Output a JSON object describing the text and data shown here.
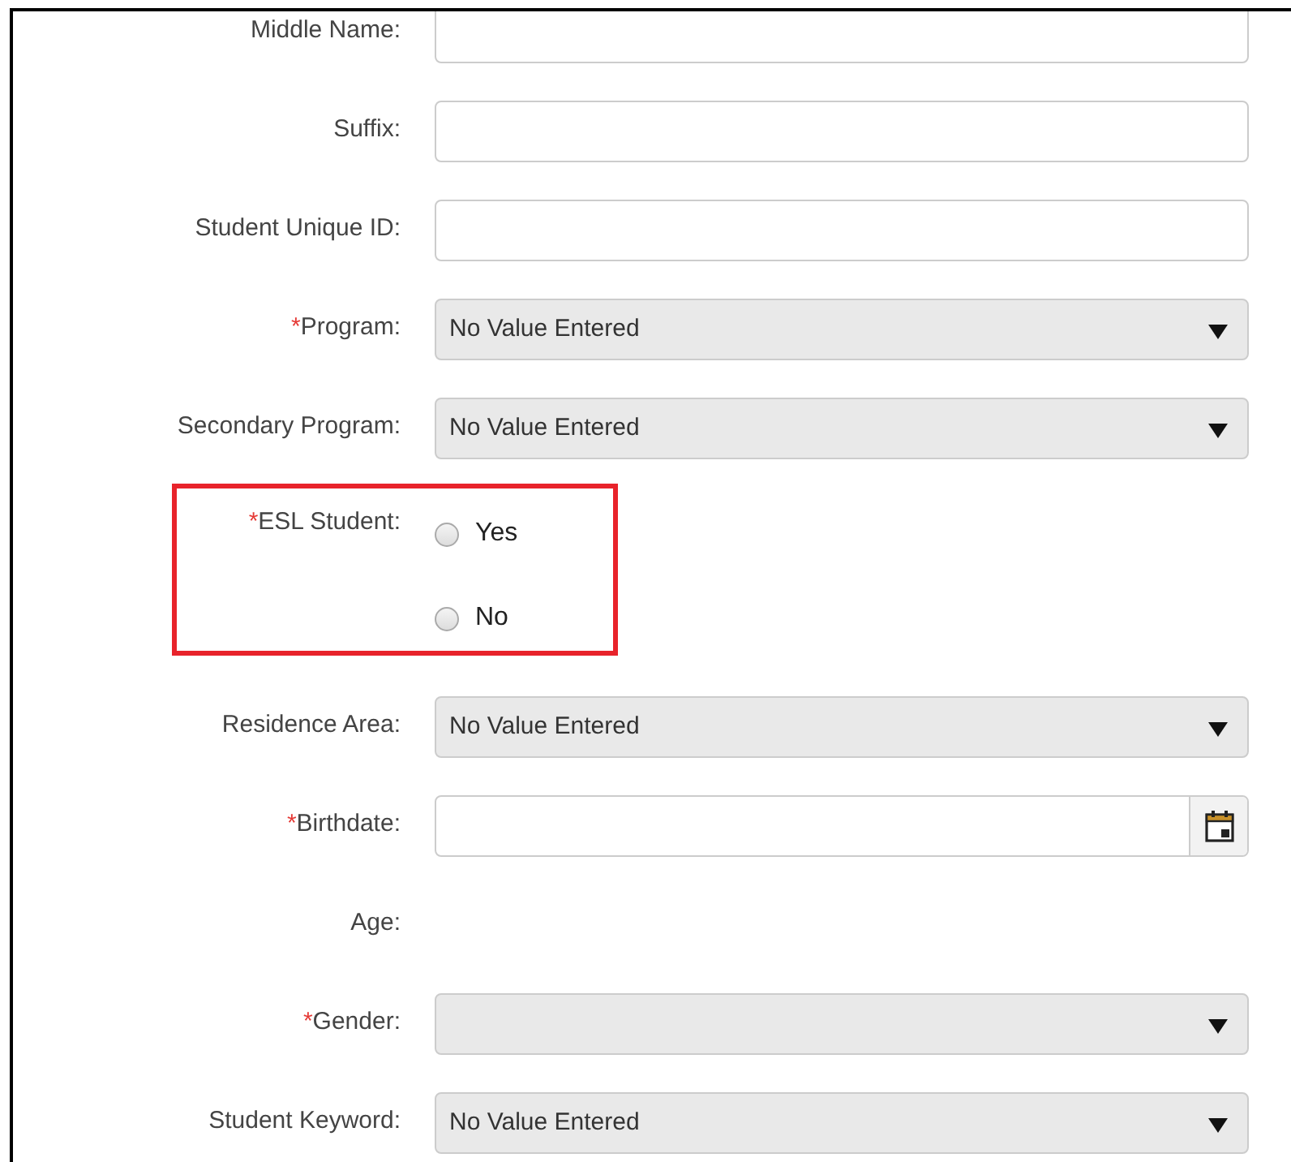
{
  "fields": [
    {
      "kind": "text",
      "label": "Middle Name:"
    },
    {
      "kind": "text",
      "label": "Suffix:"
    },
    {
      "kind": "text",
      "label": "Student Unique ID:"
    },
    {
      "kind": "select",
      "label": "Program:",
      "required_mark": "*",
      "value": "No Value Entered"
    },
    {
      "kind": "select",
      "label": "Secondary Program:",
      "value": "No Value Entered"
    },
    {
      "kind": "radio",
      "label": "ESL Student:",
      "required_mark": "*",
      "highlighted": true,
      "options": [
        {
          "label": "Yes",
          "selected": false
        },
        {
          "label": "No",
          "selected": false
        }
      ]
    },
    {
      "kind": "select",
      "label": "Residence Area:",
      "value": "No Value Entered"
    },
    {
      "kind": "date",
      "label": "Birthdate:",
      "required_mark": "*"
    },
    {
      "kind": "readonly",
      "label": "Age:"
    },
    {
      "kind": "select",
      "label": "Gender:",
      "required_mark": "*"
    },
    {
      "kind": "select",
      "label": "Student Keyword:",
      "value": "No Value Entered"
    }
  ]
}
